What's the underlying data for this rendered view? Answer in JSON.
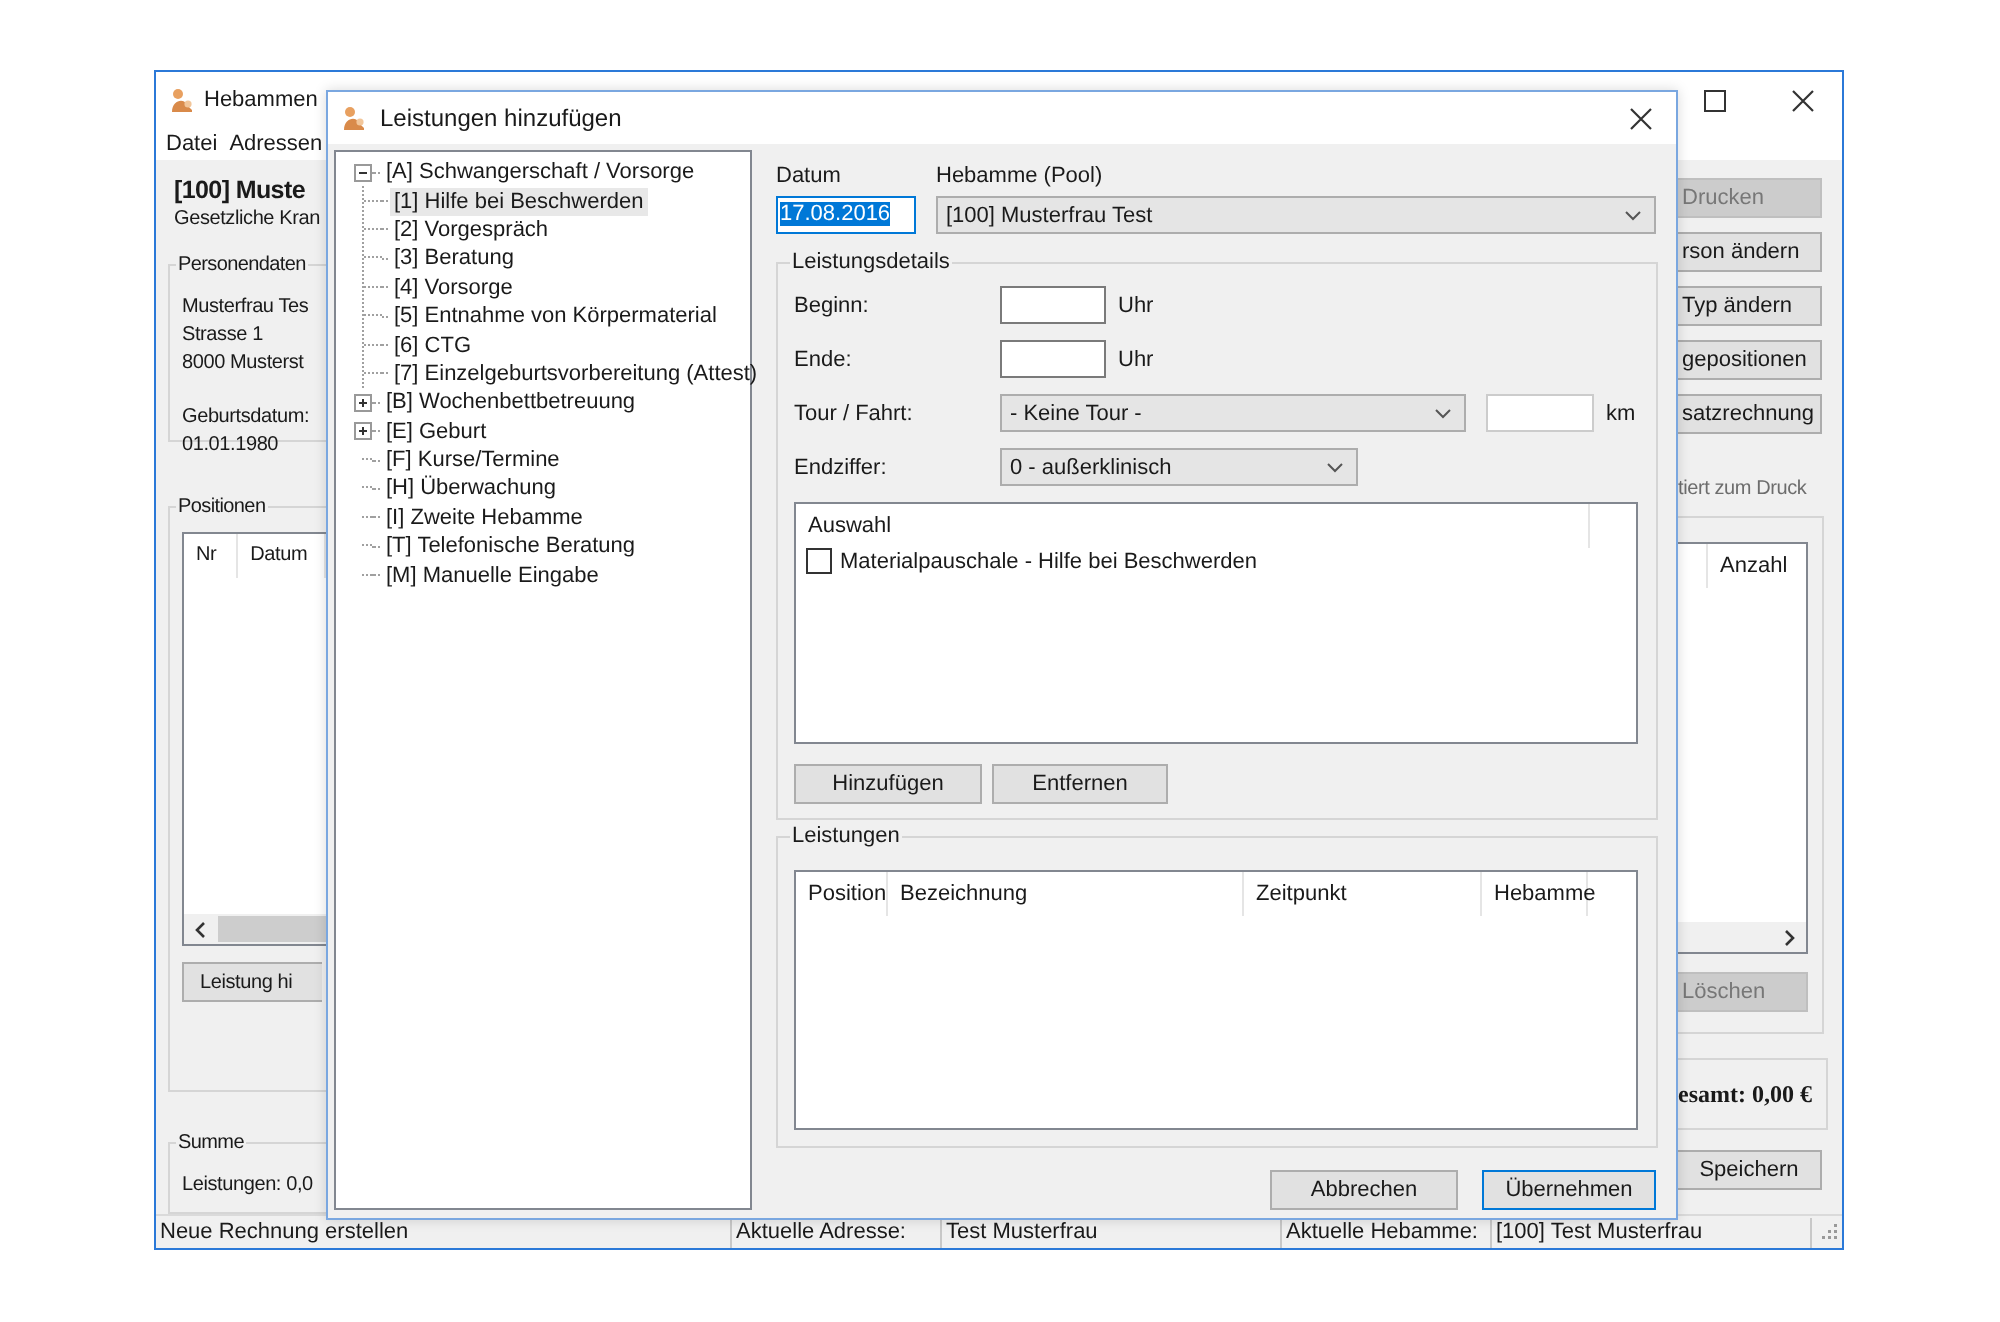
{
  "main_window": {
    "title": "Hebammen",
    "menu": [
      {
        "label": "Datei"
      },
      {
        "label": "Adressen"
      }
    ],
    "heading": "[100] Muste",
    "subheading": "Gesetzliche Kran",
    "personal_data": {
      "label": "Personendaten",
      "lines": [
        "Musterfrau Tes",
        "Strasse 1",
        "8000 Musterst"
      ],
      "birth_label": "Geburtsdatum:",
      "birth_date": "01.01.1980"
    },
    "positions": {
      "label": "Positionen",
      "columns": [
        "Nr",
        "Datum"
      ],
      "button": "Leistung hi"
    },
    "sum": {
      "label": "Summe",
      "text": "Leistungen: 0,0"
    },
    "side_buttons": [
      {
        "label": "Drucken",
        "disabled": true
      },
      {
        "label": "rson ändern",
        "disabled": false
      },
      {
        "label": "Typ ändern",
        "disabled": false
      },
      {
        "label": "gepositionen",
        "disabled": false
      },
      {
        "label": "satzrechnung",
        "disabled": false
      }
    ],
    "print_note": "tiert zum Druck",
    "list_columns": [
      "Anzahl"
    ],
    "delete_button": {
      "label": "Löschen",
      "disabled": true
    },
    "total": "esamt: 0,00 €",
    "save_button": "Speichern"
  },
  "dialog": {
    "title": "Leistungen hinzufügen",
    "tree": [
      {
        "label": "[A] Schwangerschaft / Vorsorge",
        "selected": false,
        "expanded": true,
        "children": [
          {
            "label": "[1] Hilfe bei Beschwerden",
            "selected": true
          },
          {
            "label": "[2] Vorgespräch",
            "selected": false
          },
          {
            "label": "[3] Beratung",
            "selected": false
          },
          {
            "label": "[4] Vorsorge",
            "selected": false
          },
          {
            "label": "[5] Entnahme von Körpermaterial",
            "selected": false
          },
          {
            "label": "[6] CTG",
            "selected": false
          },
          {
            "label": "[7] Einzelgeburtsvorbereitung (Attest)",
            "selected": false
          }
        ]
      },
      {
        "label": "[B] Wochenbettbetreuung",
        "selected": false,
        "expanded": false
      },
      {
        "label": "[E] Geburt",
        "selected": false,
        "expanded": false
      },
      {
        "label": "[F] Kurse/Termine",
        "selected": false
      },
      {
        "label": "[H] Überwachung",
        "selected": false
      },
      {
        "label": "[I] Zweite Hebamme",
        "selected": false
      },
      {
        "label": "[T] Telefonische Beratung",
        "selected": false
      },
      {
        "label": "[M] Manuelle Eingabe",
        "selected": false
      }
    ],
    "date_label": "Datum",
    "date": "17.08.2016",
    "midwife_label": "Hebamme (Pool)",
    "midwife": "[100] Musterfrau Test",
    "details": {
      "label": "Leistungsdetails",
      "fields": [
        {
          "kind": "time",
          "label": "Beginn:",
          "unit": "Uhr"
        },
        {
          "kind": "time",
          "label": "Ende:",
          "unit": "Uhr"
        },
        {
          "kind": "tour",
          "label": "Tour / Fahrt:",
          "value": "- Keine Tour -",
          "unit": "km"
        },
        {
          "kind": "select",
          "label": "Endziffer:",
          "value": "0 - außerklinisch"
        }
      ],
      "selection": {
        "columns": [
          "Auswahl"
        ],
        "items": [
          {
            "label": "Materialpauschale - Hilfe bei Beschwerden",
            "checked": false
          }
        ]
      },
      "buttons": [
        "Hinzufügen",
        "Entfernen"
      ]
    },
    "services": {
      "label": "Leistungen",
      "columns": [
        "Position",
        "Bezeichnung",
        "Zeitpunkt",
        "Hebamme"
      ]
    },
    "buttons": [
      {
        "label": "Abbrechen",
        "default": false
      },
      {
        "label": "Übernehmen",
        "default": true
      }
    ]
  },
  "status_bar": [
    {
      "text": "Neue Rechnung erstellen"
    },
    {
      "text": "Aktuelle Adresse:"
    },
    {
      "text": "Test Musterfrau"
    },
    {
      "text": "Aktuelle Hebamme:"
    },
    {
      "text": "[100] Test Musterfrau"
    }
  ]
}
